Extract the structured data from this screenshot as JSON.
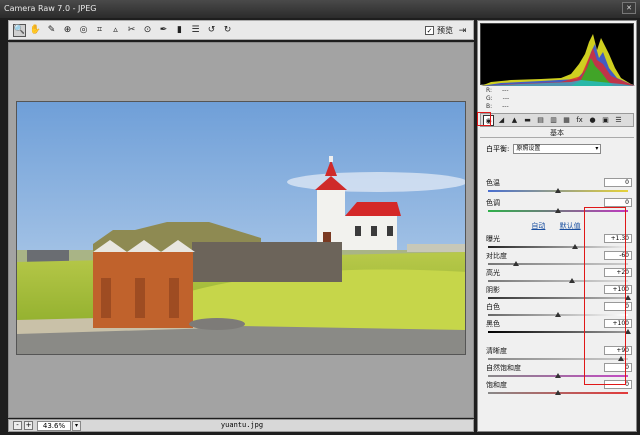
{
  "window": {
    "title": "Camera Raw 7.0 - JPEG",
    "close_label": "✕"
  },
  "toolbar": {
    "tools": [
      "zoom-icon",
      "hand-icon",
      "eyedropper-icon",
      "color-sampler-icon",
      "target-adjust-icon",
      "crop-icon",
      "straighten-icon",
      "spot-removal-icon",
      "red-eye-icon",
      "adjustment-brush-icon",
      "graduated-filter-icon",
      "preferences-icon",
      "rotate-ccw-icon",
      "rotate-cw-icon"
    ],
    "tool_glyphs": [
      "🔍",
      "✋",
      "✎",
      "⊕",
      "◎",
      "⌗",
      "▵",
      "✂",
      "⊙",
      "✒",
      "▮",
      "☰",
      "↺",
      "↻"
    ],
    "preview_label": "预览",
    "preview_checked": "✓",
    "fullscreen_glyph": "⇥"
  },
  "statusbar": {
    "zoom_out": "-",
    "zoom_in": "+",
    "zoom_value": "43.6%",
    "zoom_dropdown": "▾",
    "filename": "yuantu.jpg"
  },
  "histogram": {
    "rgb": {
      "r_label": "R:",
      "r_value": "---",
      "g_label": "G:",
      "g_value": "---",
      "b_label": "B:",
      "b_value": "---"
    }
  },
  "panel": {
    "tab_glyphs": [
      "◉",
      "◢",
      "▲",
      "▬",
      "▤",
      "▥",
      "▦",
      "fx",
      "●",
      "▣",
      "☰"
    ],
    "title": "基本",
    "white_balance_label": "白平衡:",
    "white_balance_value": "原照设置",
    "auto_link": "自动",
    "default_link": "默认值",
    "sliders": [
      {
        "label": "色温",
        "value": "0",
        "pos": 0.5
      },
      {
        "label": "色调",
        "value": "0",
        "pos": 0.5
      },
      {
        "label": "曝光",
        "value": "+1.30",
        "pos": 0.62
      },
      {
        "label": "对比度",
        "value": "-60",
        "pos": 0.2
      },
      {
        "label": "高光",
        "value": "+20",
        "pos": 0.6
      },
      {
        "label": "阴影",
        "value": "+100",
        "pos": 1.0
      },
      {
        "label": "白色",
        "value": "0",
        "pos": 0.5
      },
      {
        "label": "黑色",
        "value": "+100",
        "pos": 1.0
      },
      {
        "label": "清晰度",
        "value": "+90",
        "pos": 0.95
      },
      {
        "label": "自然饱和度",
        "value": "0",
        "pos": 0.5
      },
      {
        "label": "饱和度",
        "value": "0",
        "pos": 0.5
      }
    ]
  },
  "colors": {
    "highlight": "#e01818",
    "link": "#1a4fa0"
  }
}
